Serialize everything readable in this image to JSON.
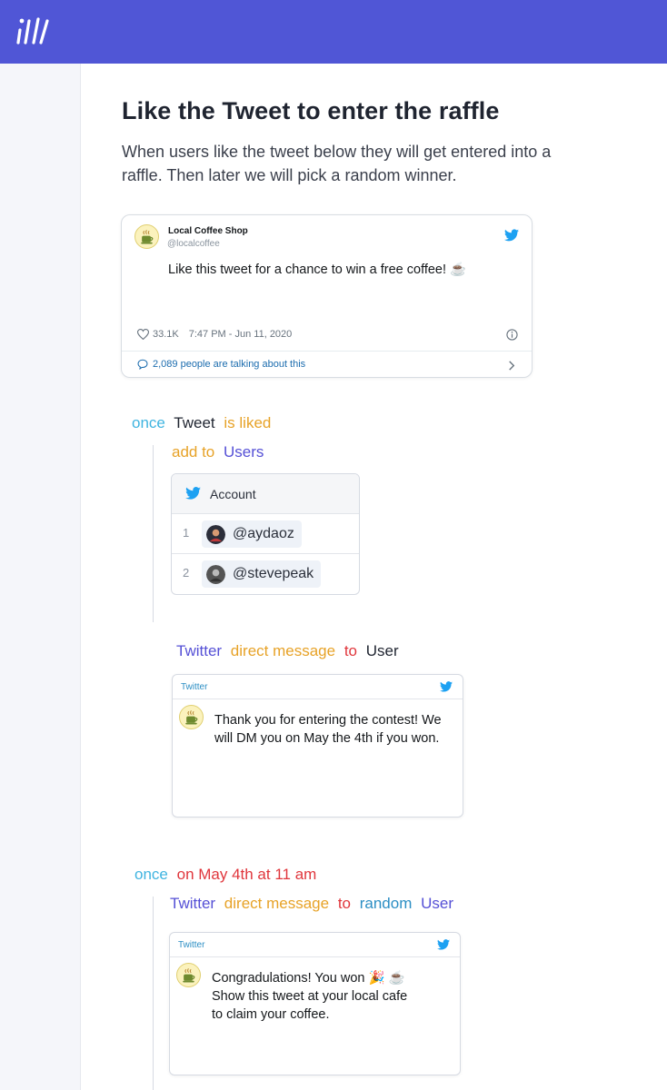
{
  "header": {
    "logo_icon": "zapier-style-slash-logo",
    "brand_color": "#5056d6"
  },
  "page": {
    "title": "Like the Tweet to enter the raffle",
    "description": "When users like the tweet below they will get entered into a raffle. Then later we will pick a random winner."
  },
  "tweet": {
    "name": "Local Coffee Shop",
    "handle": "@localcoffee",
    "text": "Like this tweet for a chance to win a free coffee! ☕",
    "likes": "33.1K",
    "timestamp": "7:47 PM - Jun 11, 2020",
    "talking": "2,089 people are talking about this"
  },
  "step1": {
    "once": "once",
    "subject": "Tweet",
    "condition": "is liked",
    "action": "add to",
    "target": "Users"
  },
  "accounts": {
    "header": "Account",
    "rows": [
      {
        "num": "1",
        "handle": "@aydaoz"
      },
      {
        "num": "2",
        "handle": "@stevepeak"
      }
    ]
  },
  "step2": {
    "service": "Twitter",
    "action": "direct message",
    "prep": "to",
    "target": "User"
  },
  "dm1": {
    "label": "Twitter",
    "text": "Thank you for entering the contest! We will DM you on May the 4th if you won."
  },
  "step3": {
    "once": "once",
    "when": "on May 4th at 11 am",
    "service": "Twitter",
    "action": "direct message",
    "prep": "to",
    "modifier": "random",
    "target": "User"
  },
  "dm2": {
    "label": "Twitter",
    "line1": "Congradulations! You won 🎉 ☕",
    "line2": "Show this tweet at your local cafe",
    "line3": "to claim your coffee."
  }
}
